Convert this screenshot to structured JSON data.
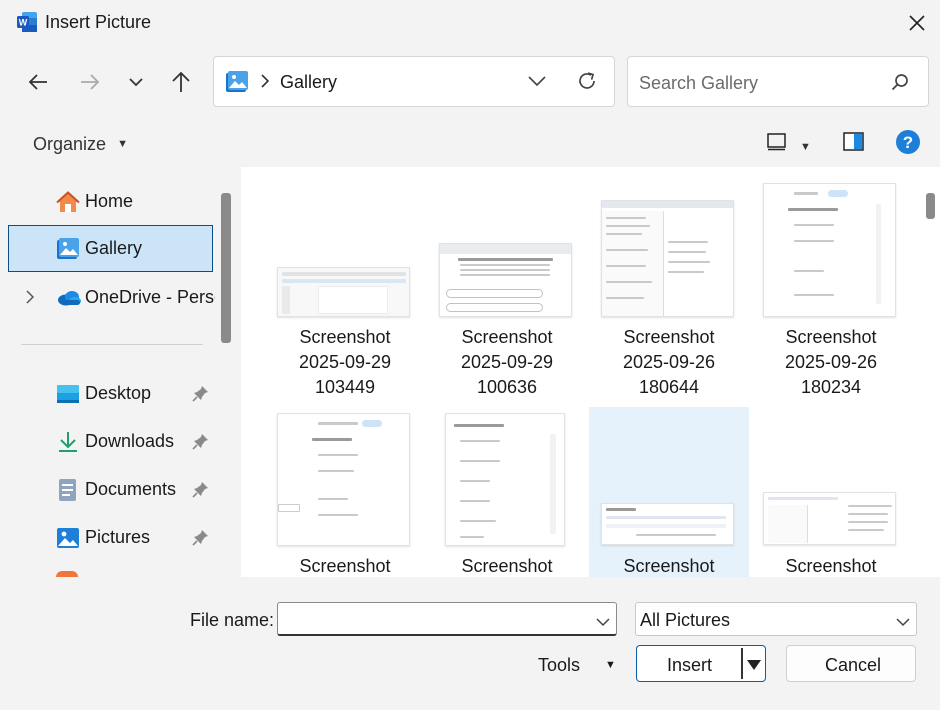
{
  "window": {
    "title": "Insert Picture"
  },
  "address": {
    "location": "Gallery"
  },
  "search": {
    "placeholder": "Search Gallery"
  },
  "toolbar": {
    "organize_label": "Organize"
  },
  "nav": {
    "items": [
      {
        "label": "Home",
        "icon": "home-icon"
      },
      {
        "label": "Gallery",
        "icon": "gallery-icon",
        "selected": true
      },
      {
        "label": "OneDrive - Perso",
        "icon": "onedrive-icon"
      },
      {
        "label": "Desktop",
        "icon": "desktop-icon",
        "pinned": true
      },
      {
        "label": "Downloads",
        "icon": "downloads-icon",
        "pinned": true
      },
      {
        "label": "Documents",
        "icon": "documents-icon",
        "pinned": true
      },
      {
        "label": "Pictures",
        "icon": "pictures-icon",
        "pinned": true
      }
    ]
  },
  "files": [
    {
      "name1": "Screenshot",
      "name2": "2025-09-29",
      "name3": "103449"
    },
    {
      "name1": "Screenshot",
      "name2": "2025-09-29",
      "name3": "100636"
    },
    {
      "name1": "Screenshot",
      "name2": "2025-09-26",
      "name3": "180644"
    },
    {
      "name1": "Screenshot",
      "name2": "2025-09-26",
      "name3": "180234"
    },
    {
      "name1": "Screenshot"
    },
    {
      "name1": "Screenshot"
    },
    {
      "name1": "Screenshot",
      "selected": true
    },
    {
      "name1": "Screenshot"
    }
  ],
  "bottom": {
    "file_name_label": "File name:",
    "file_name_value": "",
    "filter_value": "All Pictures",
    "tools_label": "Tools",
    "insert_label": "Insert",
    "cancel_label": "Cancel"
  },
  "colors": {
    "accent": "#0067c0",
    "selected_bg": "#cce4f7",
    "word_blue": "#185abd"
  }
}
